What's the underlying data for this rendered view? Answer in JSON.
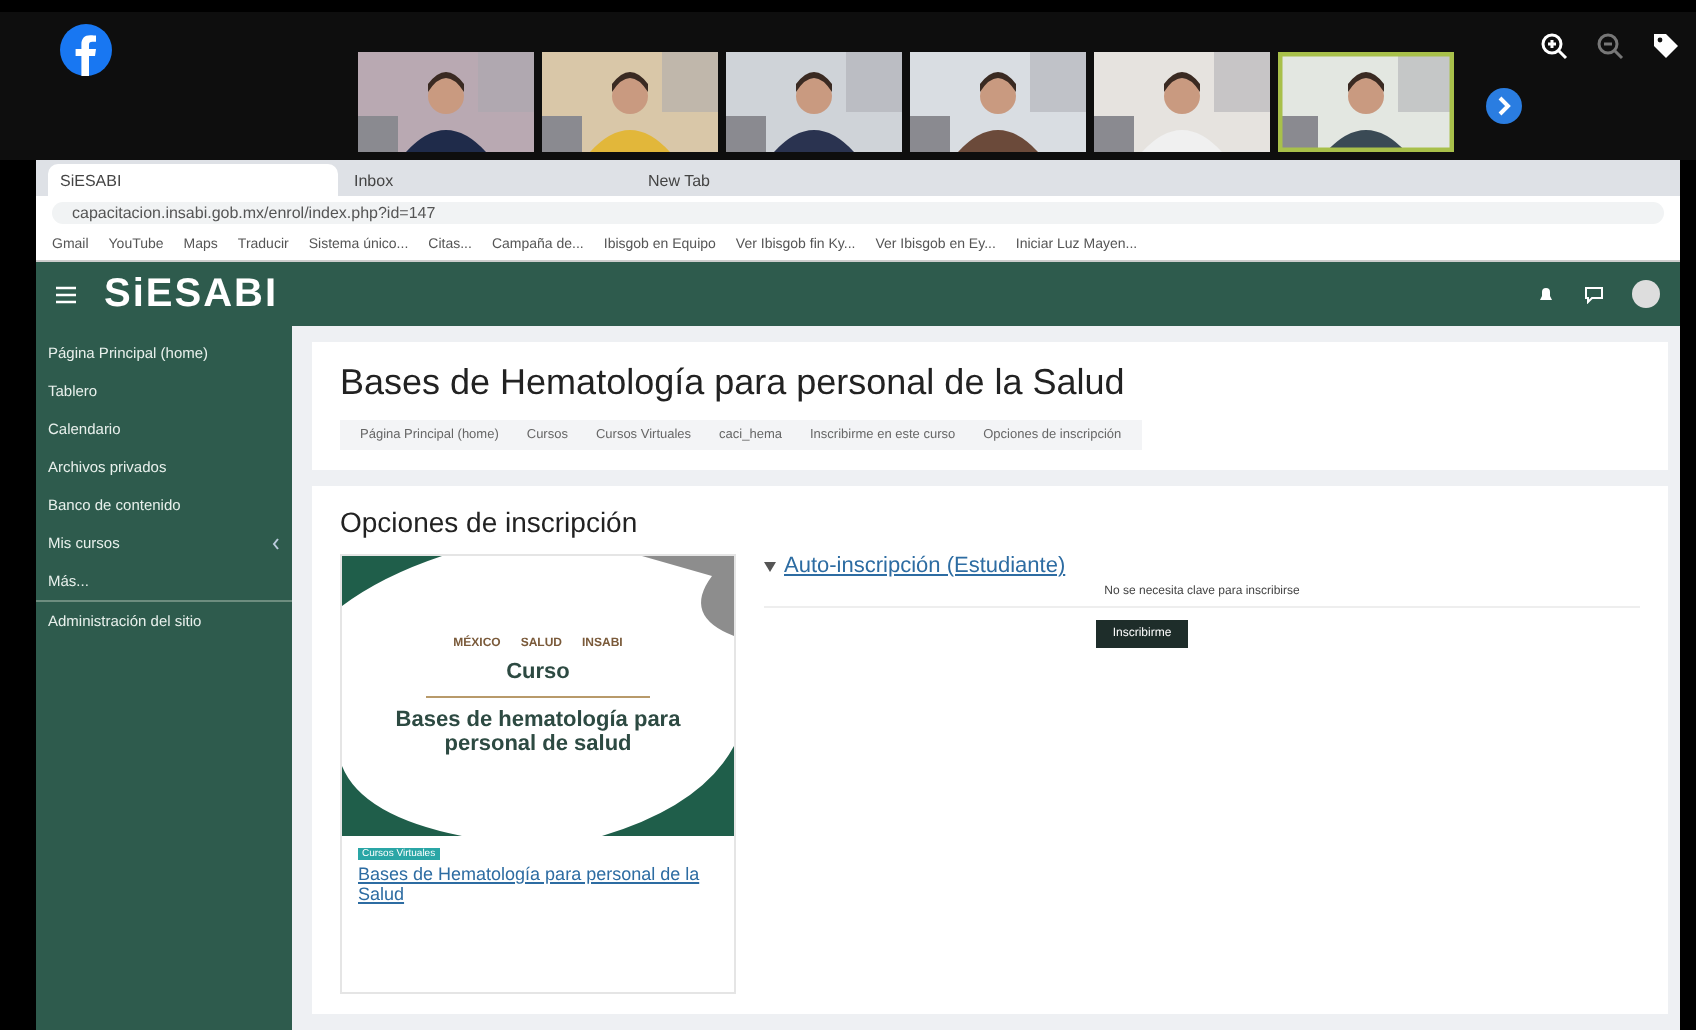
{
  "call": {
    "participants": [
      {
        "selected": false
      },
      {
        "selected": false
      },
      {
        "selected": false
      },
      {
        "selected": false
      },
      {
        "selected": false
      },
      {
        "selected": true
      }
    ]
  },
  "browser": {
    "tabs": [
      {
        "label": "SiESABI",
        "selected": true
      },
      {
        "label": "Inbox",
        "selected": false
      },
      {
        "label": "New Tab",
        "selected": false
      }
    ],
    "url": "capacitacion.insabi.gob.mx/enrol/index.php?id=147",
    "bookmarks": [
      "Gmail",
      "YouTube",
      "Maps",
      "Traducir",
      "Sistema único...",
      "Citas...",
      "Campaña de...",
      "Ibisgob en Equipo",
      "Ver Ibisgob fin Ky...",
      "Ver Ibisgob en Ey...",
      "Iniciar Luz Mayen..."
    ]
  },
  "site": {
    "brand": "SiESABI",
    "menu": [
      {
        "label": "Página Principal (home)",
        "divider_above": false,
        "expandable": false
      },
      {
        "label": "Tablero",
        "divider_above": false,
        "expandable": false
      },
      {
        "label": "Calendario",
        "divider_above": false,
        "expandable": false
      },
      {
        "label": "Archivos privados",
        "divider_above": false,
        "expandable": false
      },
      {
        "label": "Banco de contenido",
        "divider_above": false,
        "expandable": false
      },
      {
        "label": "Mis cursos",
        "divider_above": false,
        "expandable": true
      },
      {
        "label": "Más...",
        "divider_above": false,
        "expandable": false
      },
      {
        "label": "Administración del sitio",
        "divider_above": true,
        "expandable": false
      }
    ],
    "course_title": "Bases de Hematología para personal de la Salud",
    "breadcrumb": [
      "Página Principal (home)",
      "Cursos",
      "Cursos Virtuales",
      "caci_hema",
      "Inscribirme en este curso",
      "Opciones de inscripción"
    ],
    "section_title": "Opciones de inscripción",
    "card": {
      "logos": [
        "MÉXICO",
        "SALUD",
        "INSABI"
      ],
      "label": "Curso",
      "image_title": "Bases de hematología para personal de salud",
      "category": "Cursos Virtuales",
      "link": "Bases de Hematología para personal de la Salud"
    },
    "enrol": {
      "title": "Auto-inscripción (Estudiante)",
      "expanded": true,
      "note": "No se necesita clave para inscribirse",
      "button": "Inscribirme"
    }
  }
}
